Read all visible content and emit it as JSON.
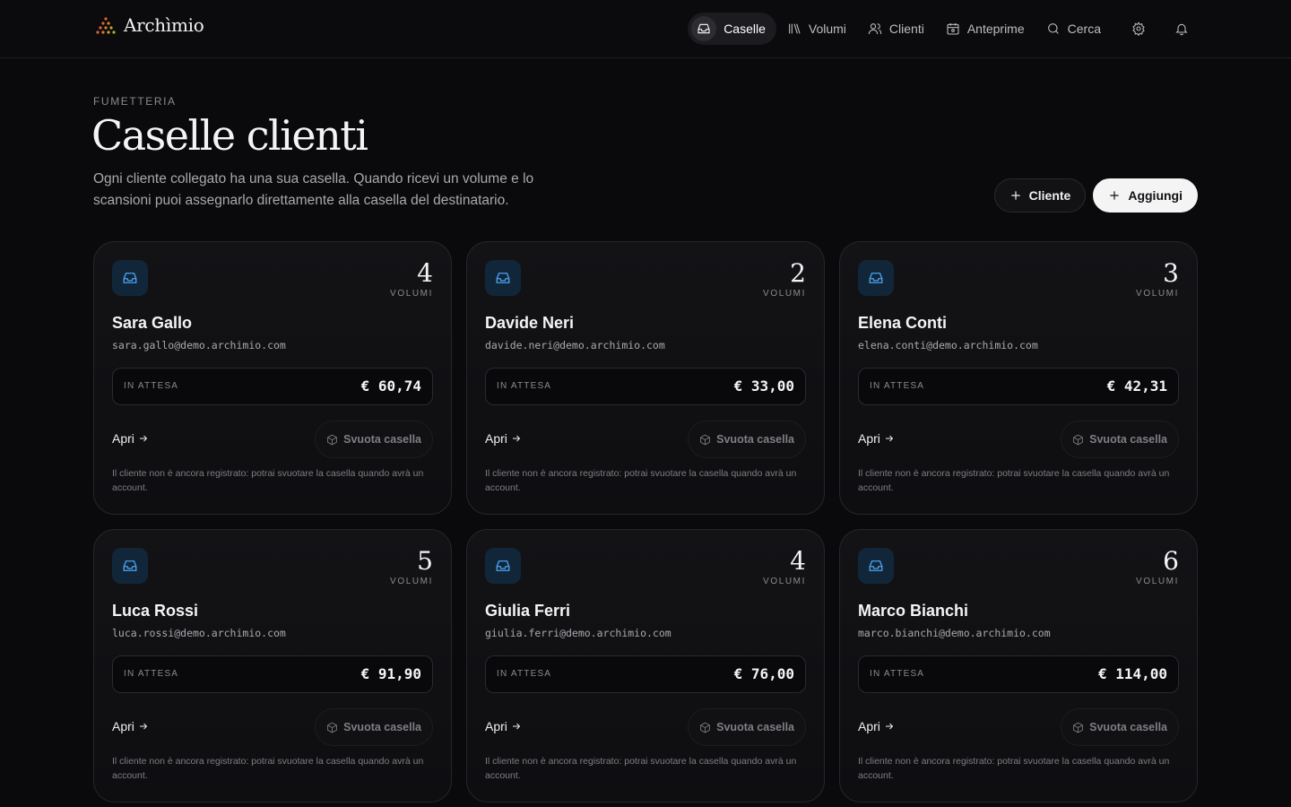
{
  "app": {
    "name": "Archìmio"
  },
  "nav": {
    "items": [
      {
        "label": "Caselle",
        "icon": "inbox-icon",
        "active": true
      },
      {
        "label": "Volumi",
        "icon": "library-icon",
        "active": false
      },
      {
        "label": "Clienti",
        "icon": "users-icon",
        "active": false
      },
      {
        "label": "Anteprime",
        "icon": "calendar-icon",
        "active": false
      },
      {
        "label": "Cerca",
        "icon": "search-icon",
        "active": false
      }
    ],
    "settings_icon": "gear-icon",
    "notifications_icon": "bell-icon"
  },
  "header": {
    "eyebrow": "FUMETTERIA",
    "title": "Caselle clienti",
    "subtitle": "Ogni cliente collegato ha una sua casella. Quando ricevi un volume e lo scansioni puoi assegnarlo direttamente alla casella del destinatario.",
    "add_client_label": "Cliente",
    "add_label": "Aggiungi"
  },
  "cards": [
    {
      "count": "4",
      "count_label": "VOLUMI",
      "name": "Sara Gallo",
      "email": "sara.gallo@demo.archimio.com",
      "pending_label": "IN ATTESA",
      "pending_amount": "€ 60,74",
      "open_label": "Apri",
      "empty_label": "Svuota casella",
      "note": "Il cliente non è ancora registrato: potrai svuotare la casella quando avrà un account."
    },
    {
      "count": "2",
      "count_label": "VOLUMI",
      "name": "Davide Neri",
      "email": "davide.neri@demo.archimio.com",
      "pending_label": "IN ATTESA",
      "pending_amount": "€ 33,00",
      "open_label": "Apri",
      "empty_label": "Svuota casella",
      "note": "Il cliente non è ancora registrato: potrai svuotare la casella quando avrà un account."
    },
    {
      "count": "3",
      "count_label": "VOLUMI",
      "name": "Elena Conti",
      "email": "elena.conti@demo.archimio.com",
      "pending_label": "IN ATTESA",
      "pending_amount": "€ 42,31",
      "open_label": "Apri",
      "empty_label": "Svuota casella",
      "note": "Il cliente non è ancora registrato: potrai svuotare la casella quando avrà un account."
    },
    {
      "count": "5",
      "count_label": "VOLUMI",
      "name": "Luca Rossi",
      "email": "luca.rossi@demo.archimio.com",
      "pending_label": "IN ATTESA",
      "pending_amount": "€ 91,90",
      "open_label": "Apri",
      "empty_label": "Svuota casella",
      "note": "Il cliente non è ancora registrato: potrai svuotare la casella quando avrà un account."
    },
    {
      "count": "4",
      "count_label": "VOLUMI",
      "name": "Giulia Ferri",
      "email": "giulia.ferri@demo.archimio.com",
      "pending_label": "IN ATTESA",
      "pending_amount": "€ 76,00",
      "open_label": "Apri",
      "empty_label": "Svuota casella",
      "note": "Il cliente non è ancora registrato: potrai svuotare la casella quando avrà un account."
    },
    {
      "count": "6",
      "count_label": "VOLUMI",
      "name": "Marco Bianchi",
      "email": "marco.bianchi@demo.archimio.com",
      "pending_label": "IN ATTESA",
      "pending_amount": "€ 114,00",
      "open_label": "Apri",
      "empty_label": "Svuota casella",
      "note": "Il cliente non è ancora registrato: potrai svuotare la casella quando avrà un account."
    }
  ],
  "colors": {
    "background": "#0a0a0c",
    "accent": "#4aa3ee",
    "logo_dots": "#e0623a"
  }
}
